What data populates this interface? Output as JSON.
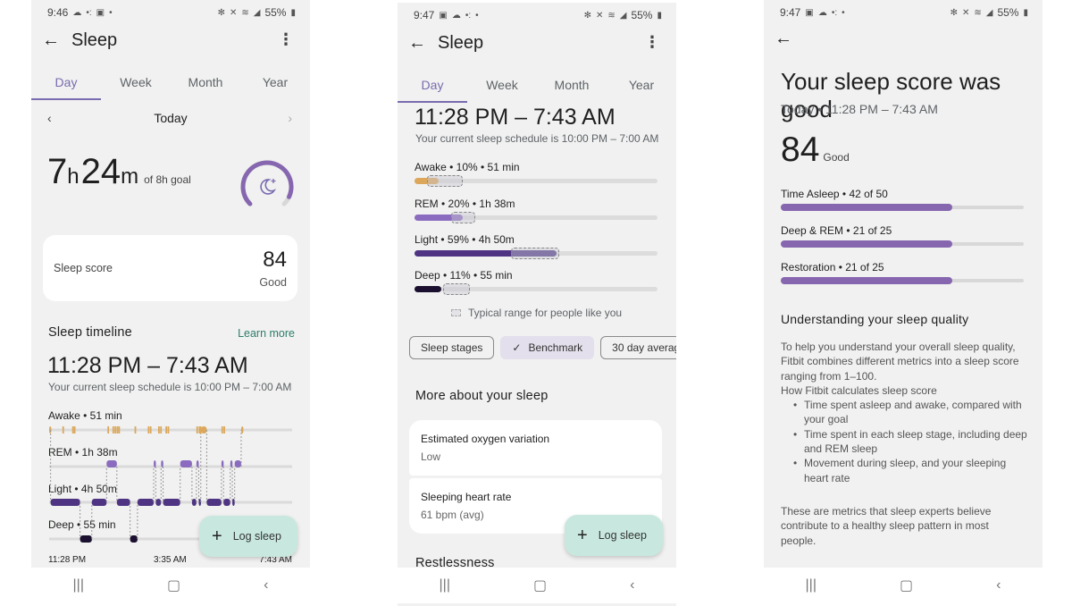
{
  "screens": [
    {
      "status": {
        "time": "9:46",
        "battery": "55%"
      },
      "appbar": {
        "title": "Sleep"
      },
      "tabs": [
        {
          "label": "Day",
          "active": true
        },
        {
          "label": "Week"
        },
        {
          "label": "Month"
        },
        {
          "label": "Year"
        }
      ],
      "date_nav": {
        "label": "Today"
      },
      "duration": {
        "hours": "7",
        "h_unit": "h",
        "minutes": "24",
        "m_unit": "m",
        "goal": "of 8h goal",
        "progress_fraction": 0.925
      },
      "sleep_score": {
        "label": "Sleep score",
        "value": "84",
        "quality": "Good"
      },
      "timeline": {
        "title": "Sleep timeline",
        "learn_more": "Learn more",
        "range": "11:28 PM – 7:43 AM",
        "schedule": "Your current sleep schedule is 10:00 PM – 7:00 AM",
        "stages": [
          {
            "key": "awake",
            "label": "Awake • 51 min"
          },
          {
            "key": "rem",
            "label": "REM • 1h 38m"
          },
          {
            "key": "light",
            "label": "Light • 4h 50m"
          },
          {
            "key": "deep",
            "label": "Deep • 55 min"
          }
        ],
        "axis": [
          "11:28 PM",
          "3:35 AM",
          "7:43 AM"
        ],
        "start_hour": 23.467,
        "end_hour": 31.717,
        "segments": [
          [
            "awake",
            0.0,
            0.05
          ],
          [
            "light",
            0.05,
            1.05
          ],
          [
            "deep",
            1.05,
            1.45
          ],
          [
            "light",
            1.45,
            1.95
          ],
          [
            "rem",
            1.95,
            2.3
          ],
          [
            "light",
            2.3,
            2.75
          ],
          [
            "deep",
            2.75,
            3.0
          ],
          [
            "light",
            3.0,
            3.55
          ],
          [
            "rem",
            3.55,
            3.62
          ],
          [
            "light",
            3.62,
            3.8
          ],
          [
            "rem",
            3.8,
            3.87
          ],
          [
            "light",
            3.87,
            4.45
          ],
          [
            "rem",
            4.45,
            4.85
          ],
          [
            "light",
            4.85,
            5.0
          ],
          [
            "rem",
            5.0,
            5.08
          ],
          [
            "light",
            5.08,
            5.15
          ],
          [
            "awake",
            5.15,
            5.35
          ],
          [
            "light",
            5.35,
            5.85
          ],
          [
            "rem",
            5.85,
            5.92
          ],
          [
            "light",
            5.92,
            6.15
          ],
          [
            "rem",
            6.15,
            6.22
          ],
          [
            "light",
            6.22,
            6.3
          ],
          [
            "rem",
            6.3,
            6.52
          ],
          [
            "awake",
            6.52,
            6.58
          ]
        ],
        "awake_ticks": [
          0.45,
          0.78,
          0.84,
          1.98,
          2.15,
          2.22,
          2.29,
          2.35,
          2.9,
          3.35,
          3.42,
          3.7,
          3.77,
          3.95,
          4.02,
          5.0,
          5.08,
          5.11,
          5.85,
          5.92
        ]
      },
      "fab": {
        "label": "Log sleep"
      }
    },
    {
      "status": {
        "time": "9:47",
        "battery": "55%"
      },
      "appbar": {
        "title": "Sleep"
      },
      "tabs": [
        {
          "label": "Day",
          "active": true
        },
        {
          "label": "Week"
        },
        {
          "label": "Month"
        },
        {
          "label": "Year"
        }
      ],
      "range": "11:28 PM – 7:43 AM",
      "schedule": "Your current sleep schedule is 10:00 PM – 7:00 AM",
      "benchmark": [
        {
          "label": "Awake • 10% • 51 min",
          "percent": 10,
          "typical_range": [
            5,
            20
          ],
          "color": "#dca75a"
        },
        {
          "label": "REM • 20% • 1h 38m",
          "percent": 20,
          "typical_range": [
            15,
            25
          ],
          "color": "#8a6bbf"
        },
        {
          "label": "Light • 59% • 4h 50m",
          "percent": 59,
          "typical_range": [
            40,
            60
          ],
          "color": "#4e3482"
        },
        {
          "label": "Deep • 11% • 55 min",
          "percent": 11,
          "typical_range": [
            12,
            23
          ],
          "color": "#1b1030"
        }
      ],
      "typical_legend": "Typical range for people like you",
      "chips": [
        {
          "label": "Sleep stages"
        },
        {
          "label": "Benchmark",
          "selected": true
        },
        {
          "label": "30 day averag"
        }
      ],
      "more_title": "More about your sleep",
      "metrics": [
        {
          "name": "Estimated oxygen variation",
          "value": "Low"
        },
        {
          "name": "Sleeping heart rate",
          "value": "61 bpm (avg)"
        }
      ],
      "next_section": "Restlessness",
      "fab": {
        "label": "Log sleep"
      }
    },
    {
      "status": {
        "time": "9:47",
        "battery": "55%"
      },
      "title": "Your sleep score was good",
      "subtitle": "Today • 11:28 PM – 7:43 AM",
      "score": "84",
      "quality": "Good",
      "components": [
        {
          "label": "Time Asleep • 42 of 50",
          "value": 42,
          "max": 50
        },
        {
          "label": "Deep & REM • 21 of 25",
          "value": 21,
          "max": 25
        },
        {
          "label": "Restoration • 21 of 25",
          "value": 21,
          "max": 25
        }
      ],
      "understanding_title": "Understanding your sleep quality",
      "body_intro": "To help you understand your overall sleep quality, Fitbit combines different metrics into a sleep score ranging from 1–100.",
      "how_title": "How Fitbit calculates sleep score",
      "bullets": [
        "Time spent asleep and awake, compared with your goal",
        "Time spent in each sleep stage, including deep and REM sleep",
        "Movement during sleep, and your sleeping heart rate"
      ],
      "footer": "These are metrics that sleep experts believe contribute to a healthy sleep pattern in most people."
    }
  ],
  "nav": {
    "recents": "|||",
    "home": "▢",
    "back": "‹"
  },
  "colors": {
    "accent": "#7b6bb0",
    "awake": "#dca75a",
    "rem": "#8a6bbf",
    "light": "#4e3482",
    "deep": "#1b1030",
    "fab": "#c8e8df",
    "link": "#2e7d6b"
  }
}
